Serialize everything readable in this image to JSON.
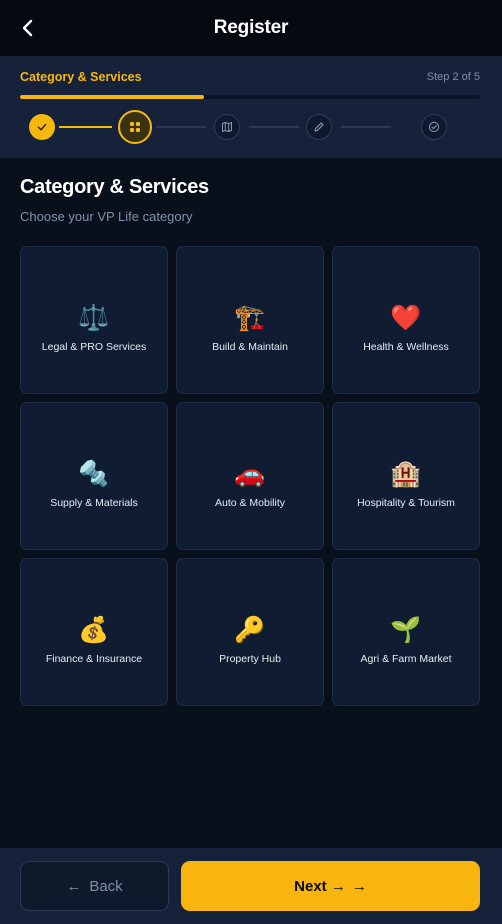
{
  "header": {
    "title": "Register"
  },
  "progress": {
    "step_name": "Category & Services",
    "step_count": "Step 2 of 5",
    "fraction": 0.4,
    "steps": [
      {
        "state": "done",
        "icon": "check-icon"
      },
      {
        "state": "current",
        "icon": "grid-icon"
      },
      {
        "state": "todo",
        "icon": "map-icon"
      },
      {
        "state": "todo",
        "icon": "pencil-icon"
      },
      {
        "state": "todo",
        "icon": "check-circle-icon"
      }
    ]
  },
  "section": {
    "title": "Category & Services",
    "subtitle": "Choose your VP Life category"
  },
  "categories": [
    {
      "emoji": "⚖️",
      "icon": "scales-icon",
      "label": "Legal & PRO Services"
    },
    {
      "emoji": "🏗️",
      "icon": "crane-icon",
      "label": "Build & Maintain"
    },
    {
      "emoji": "❤️",
      "icon": "heart-icon",
      "label": "Health & Wellness"
    },
    {
      "emoji": "🔩",
      "icon": "nut-bolt-icon",
      "label": "Supply & Materials"
    },
    {
      "emoji": "🚗",
      "icon": "car-icon",
      "label": "Auto & Mobility"
    },
    {
      "emoji": "🏨",
      "icon": "hotel-icon",
      "label": "Hospitality & Tourism"
    },
    {
      "emoji": "💰",
      "icon": "money-bag-icon",
      "label": "Finance & Insurance"
    },
    {
      "emoji": "🔑",
      "icon": "key-icon",
      "label": "Property Hub"
    },
    {
      "emoji": "🌱",
      "icon": "seedling-icon",
      "label": "Agri & Farm Market"
    }
  ],
  "footer": {
    "back_arrow": "←",
    "back_label": "Back",
    "next_label": "Next →",
    "next_arrow": "→"
  },
  "colors": {
    "accent": "#f5b80f",
    "background": "#08101c",
    "panel": "#16223a",
    "card": "#0f1c31"
  }
}
